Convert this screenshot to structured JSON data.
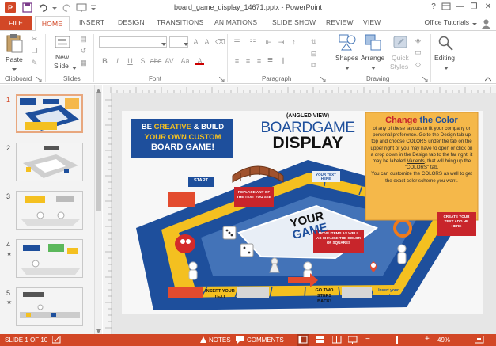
{
  "window": {
    "title": "board_game_display_14671.pptx - PowerPoint",
    "help": "?",
    "minimize": "—",
    "restore": "❐",
    "close": "✕"
  },
  "tabs": [
    "FILE",
    "HOME",
    "INSERT",
    "DESIGN",
    "TRANSITIONS",
    "ANIMATIONS",
    "SLIDE SHOW",
    "REVIEW",
    "VIEW"
  ],
  "account": "Office Tutorials",
  "ribbon": {
    "clipboard": {
      "label": "Clipboard",
      "paste": "Paste"
    },
    "slides": {
      "label": "Slides",
      "new_slide_1": "New",
      "new_slide_2": "Slide"
    },
    "font": {
      "label": "Font"
    },
    "paragraph": {
      "label": "Paragraph"
    },
    "drawing": {
      "label": "Drawing",
      "shapes": "Shapes",
      "arrange": "Arrange",
      "quick_styles_1": "Quick",
      "quick_styles_2": "Styles"
    },
    "editing": {
      "label": "Editing"
    },
    "format_labels": [
      "B",
      "I",
      "U",
      "S",
      "abc",
      "AV",
      "Aa",
      "A"
    ]
  },
  "thumbnails": {
    "numbers": [
      "1",
      "2",
      "3",
      "4",
      "5"
    ],
    "star": "★"
  },
  "slide": {
    "banner_line1_a": "BE ",
    "banner_line1_b": "CREATIVE",
    "banner_line1_c": " & BUILD",
    "banner_line2": "YOUR OWN CUSTOM",
    "banner_line3": "BOARD GAME!",
    "angled_view": "(ANGLED VIEW)",
    "boardgame": "BOARDGAME",
    "display": "DISPLAY",
    "note_title_a": "Change",
    "note_title_b": " the Color",
    "note_body_1": "of any of these layouts to fit your company or personal preference. Go to the Design tab up top and choose COLORS under the tab on the upper right or you may have to open or click on a drop down in the Design tab to the far right, it may be labeled ",
    "note_variants": "Varients",
    "note_body_2": ", that will bring up the \"COLORS\" tab.",
    "note_body_3": "You can customize the COLORS as well to get the exact color scheme you want.",
    "your_game_1": "YOUR",
    "your_game_2": "GAME",
    "start": "START",
    "replace_text": "REPLACE ANY OF THE TEXT YOU SEE",
    "move_items": "MOVE ITEMS AS WELL AS CHANGE THE COLOR OF SQUARES",
    "create_text": "CREATE YOUR TEXT ADD HR HERE",
    "insert_text": "INSERT YOUR TEXT",
    "go_two": "GO TWO STEPS BACK!",
    "insert_personal": "Insert your personal words",
    "your_text_here": "YOUR TEXT HERE"
  },
  "status": {
    "slide_info": "SLIDE 1 OF 10",
    "notes": "NOTES",
    "comments": "COMMENTS",
    "zoom": "49%"
  },
  "colors": {
    "accent": "#d24726",
    "board_blue": "#1e4f9c",
    "board_yellow": "#f4c020",
    "note_orange": "#f5b84a"
  }
}
